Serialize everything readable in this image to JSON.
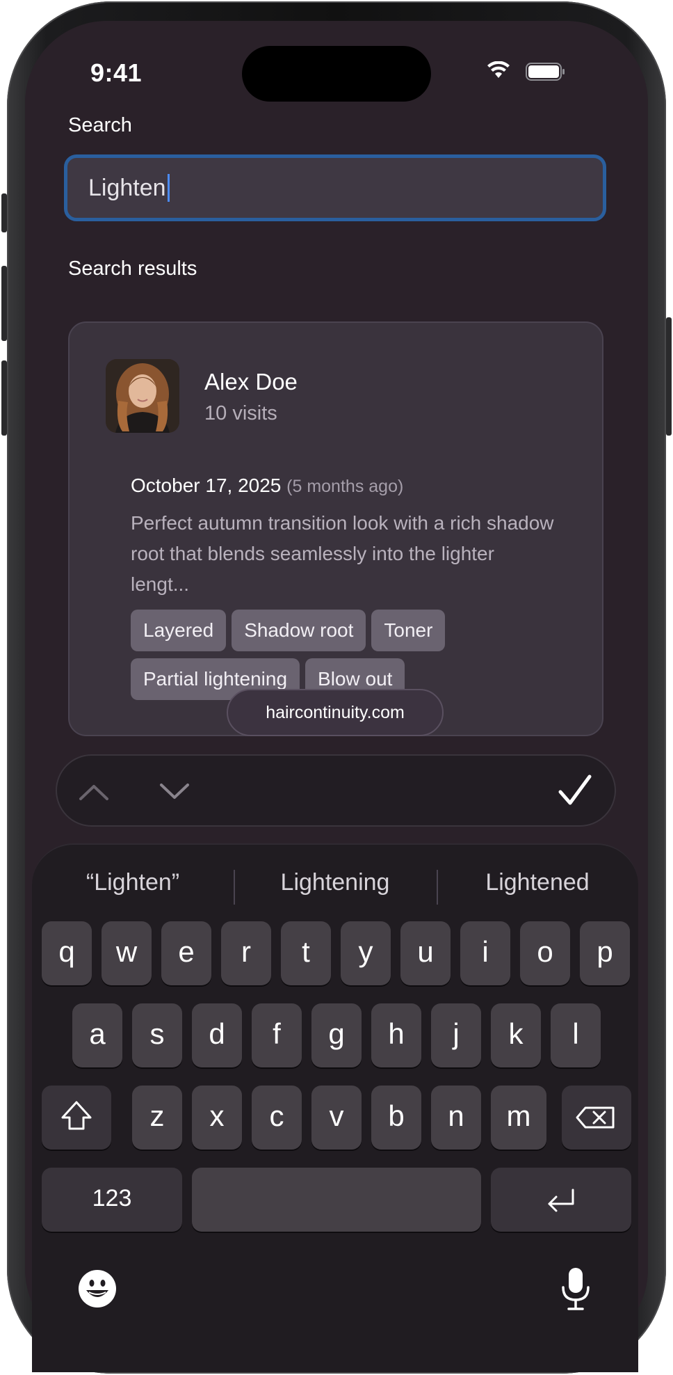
{
  "status_bar": {
    "time": "9:41"
  },
  "search": {
    "label": "Search",
    "value": "Lighten"
  },
  "results": {
    "label": "Search results",
    "card": {
      "client_name": "Alex Doe",
      "visits": "10 visits",
      "date": "October 17, 2025",
      "relative": "(5 months ago)",
      "notes": "Perfect autumn transition look with a rich shadow root that blends seamlessly into the lighter lengt...",
      "tags": [
        "Layered",
        "Shadow root",
        "Toner",
        "Partial lightening",
        "Blow out"
      ]
    }
  },
  "browser": {
    "url": "haircontinuity.com"
  },
  "find_bar": {
    "prev_icon": "chevron-up-icon",
    "next_icon": "chevron-down-icon",
    "done_icon": "checkmark-icon"
  },
  "keyboard": {
    "suggestions": [
      "“Lighten”",
      "Lightening",
      "Lightened"
    ],
    "row1": [
      "q",
      "w",
      "e",
      "r",
      "t",
      "y",
      "u",
      "i",
      "o",
      "p"
    ],
    "row2": [
      "a",
      "s",
      "d",
      "f",
      "g",
      "h",
      "j",
      "k",
      "l"
    ],
    "row3": [
      "z",
      "x",
      "c",
      "v",
      "b",
      "n",
      "m"
    ],
    "numbers_key": "123",
    "shift_icon": "shift-icon",
    "delete_icon": "delete-icon",
    "return_icon": "return-icon",
    "emoji_icon": "emoji-icon",
    "mic_icon": "microphone-icon"
  }
}
